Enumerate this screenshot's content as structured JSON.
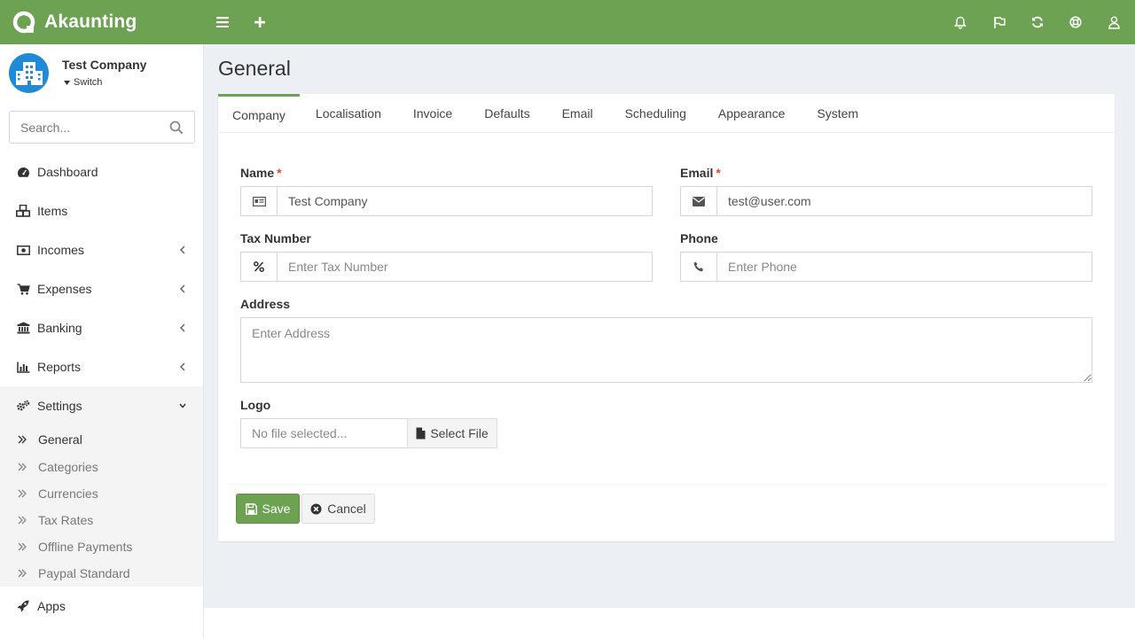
{
  "app": {
    "name": "Akaunting"
  },
  "colors": {
    "brand": "#6da252",
    "avatar": "#1f8ad6",
    "required": "#dd4b39"
  },
  "topbar": {
    "icons": [
      "menu-icon",
      "plus-icon",
      "bell-icon",
      "flag-icon",
      "refresh-icon",
      "life-ring-icon",
      "user-icon"
    ]
  },
  "company": {
    "name": "Test Company",
    "switch_label": "Switch"
  },
  "search": {
    "placeholder": "Search..."
  },
  "sidebar": {
    "items": [
      {
        "label": "Dashboard",
        "icon": "dashboard-icon"
      },
      {
        "label": "Items",
        "icon": "cubes-icon"
      },
      {
        "label": "Incomes",
        "icon": "money-icon"
      },
      {
        "label": "Expenses",
        "icon": "cart-icon"
      },
      {
        "label": "Banking",
        "icon": "bank-icon"
      },
      {
        "label": "Reports",
        "icon": "bar-chart-icon"
      },
      {
        "label": "Settings",
        "icon": "gears-icon"
      },
      {
        "label": "Apps",
        "icon": "rocket-icon"
      }
    ],
    "settings_sub": [
      "General",
      "Categories",
      "Currencies",
      "Tax Rates",
      "Offline Payments",
      "Paypal Standard"
    ]
  },
  "page": {
    "title": "General"
  },
  "tabs": [
    "Company",
    "Localisation",
    "Invoice",
    "Defaults",
    "Email",
    "Scheduling",
    "Appearance",
    "System"
  ],
  "form": {
    "name": {
      "label": "Name",
      "value": "Test Company",
      "required_mark": "*"
    },
    "email": {
      "label": "Email",
      "value": "test@user.com",
      "required_mark": "*"
    },
    "tax_number": {
      "label": "Tax Number",
      "placeholder": "Enter Tax Number"
    },
    "phone": {
      "label": "Phone",
      "placeholder": "Enter Phone"
    },
    "address": {
      "label": "Address",
      "placeholder": "Enter Address"
    },
    "logo": {
      "label": "Logo",
      "file_text": "No file selected...",
      "select_label": "Select File"
    }
  },
  "actions": {
    "save_label": "Save",
    "cancel_label": "Cancel"
  }
}
